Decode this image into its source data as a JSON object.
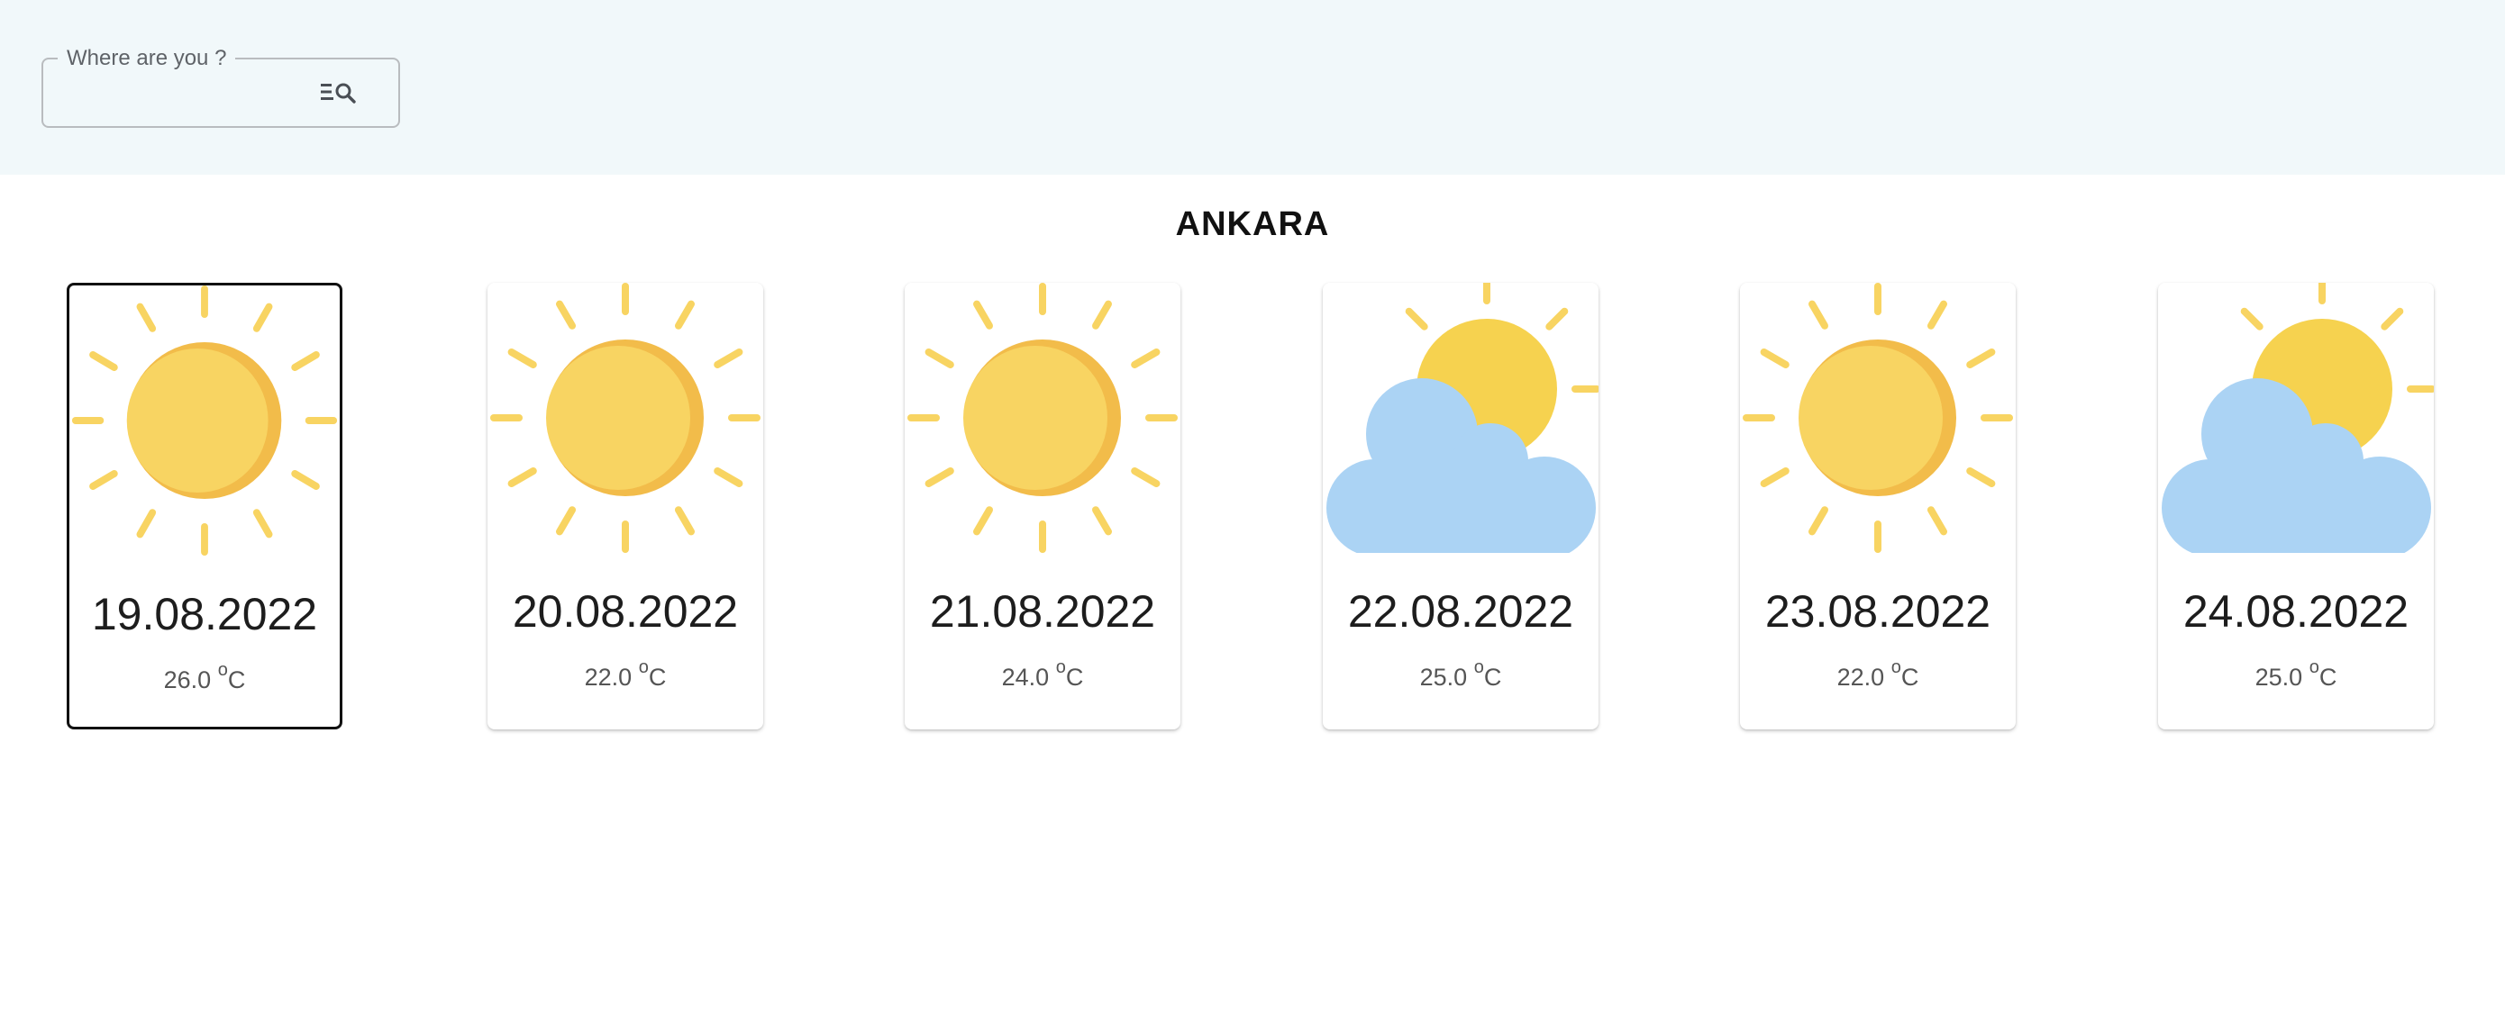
{
  "search": {
    "legend": "Where are you ?",
    "value": "",
    "button_icon": "manage-search-icon"
  },
  "city": "ANKARA",
  "colors": {
    "header_bg": "#f1f8fa",
    "sun": "#f8d462",
    "sun_shade": "#f2bc4a",
    "cloud": "#abd3f4"
  },
  "days": [
    {
      "date": "19.08.2022",
      "temp": "26.0",
      "unit_sup": "o",
      "unit": "C",
      "icon": "sun-icon",
      "selected": true
    },
    {
      "date": "20.08.2022",
      "temp": "22.0",
      "unit_sup": "o",
      "unit": "C",
      "icon": "sun-icon",
      "selected": false
    },
    {
      "date": "21.08.2022",
      "temp": "24.0",
      "unit_sup": "o",
      "unit": "C",
      "icon": "sun-icon",
      "selected": false
    },
    {
      "date": "22.08.2022",
      "temp": "25.0",
      "unit_sup": "o",
      "unit": "C",
      "icon": "partly-cloudy-icon",
      "selected": false
    },
    {
      "date": "23.08.2022",
      "temp": "22.0",
      "unit_sup": "o",
      "unit": "C",
      "icon": "sun-icon",
      "selected": false
    },
    {
      "date": "24.08.2022",
      "temp": "25.0",
      "unit_sup": "o",
      "unit": "C",
      "icon": "partly-cloudy-icon",
      "selected": false
    }
  ]
}
